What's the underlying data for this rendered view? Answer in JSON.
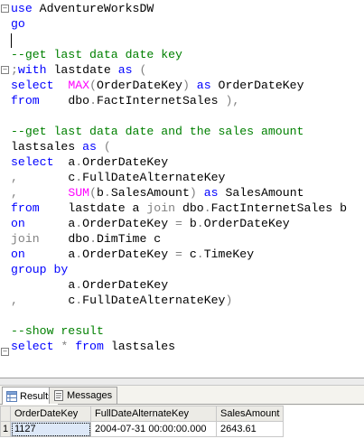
{
  "editor": {
    "lines": [
      [
        {
          "t": "use ",
          "c": "kw"
        },
        {
          "t": "AdventureWorksDW",
          "c": "id"
        }
      ],
      [
        {
          "t": "go",
          "c": "kw"
        }
      ],
      [
        {
          "t": "",
          "c": "id"
        }
      ],
      [
        {
          "t": "--get last data date key",
          "c": "cm"
        }
      ],
      [
        {
          "t": ";",
          "c": "op"
        },
        {
          "t": "with ",
          "c": "kw"
        },
        {
          "t": "lastdate ",
          "c": "id"
        },
        {
          "t": "as ",
          "c": "kw"
        },
        {
          "t": "(",
          "c": "op"
        }
      ],
      [
        {
          "t": "select  ",
          "c": "kw"
        },
        {
          "t": "MAX",
          "c": "fn"
        },
        {
          "t": "(",
          "c": "op"
        },
        {
          "t": "OrderDateKey",
          "c": "id"
        },
        {
          "t": ") ",
          "c": "op"
        },
        {
          "t": "as ",
          "c": "kw"
        },
        {
          "t": "OrderDateKey",
          "c": "id"
        }
      ],
      [
        {
          "t": "from    ",
          "c": "kw"
        },
        {
          "t": "dbo",
          "c": "id"
        },
        {
          "t": ".",
          "c": "op"
        },
        {
          "t": "FactInternetSales ",
          "c": "id"
        },
        {
          "t": "),",
          "c": "op"
        }
      ],
      [
        {
          "t": "",
          "c": "id"
        }
      ],
      [
        {
          "t": "--get last data date and the sales amount",
          "c": "cm"
        }
      ],
      [
        {
          "t": "lastsales ",
          "c": "id"
        },
        {
          "t": "as ",
          "c": "kw"
        },
        {
          "t": "(",
          "c": "op"
        }
      ],
      [
        {
          "t": "select  ",
          "c": "kw"
        },
        {
          "t": "a",
          "c": "id"
        },
        {
          "t": ".",
          "c": "op"
        },
        {
          "t": "OrderDateKey",
          "c": "id"
        }
      ],
      [
        {
          "t": ",       ",
          "c": "op"
        },
        {
          "t": "c",
          "c": "id"
        },
        {
          "t": ".",
          "c": "op"
        },
        {
          "t": "FullDateAlternateKey",
          "c": "id"
        }
      ],
      [
        {
          "t": ",       ",
          "c": "op"
        },
        {
          "t": "SUM",
          "c": "fn"
        },
        {
          "t": "(",
          "c": "op"
        },
        {
          "t": "b",
          "c": "id"
        },
        {
          "t": ".",
          "c": "op"
        },
        {
          "t": "SalesAmount",
          "c": "id"
        },
        {
          "t": ") ",
          "c": "op"
        },
        {
          "t": "as ",
          "c": "kw"
        },
        {
          "t": "SalesAmount",
          "c": "id"
        }
      ],
      [
        {
          "t": "from    ",
          "c": "kw"
        },
        {
          "t": "lastdate a ",
          "c": "id"
        },
        {
          "t": "join ",
          "c": "op"
        },
        {
          "t": "dbo",
          "c": "id"
        },
        {
          "t": ".",
          "c": "op"
        },
        {
          "t": "FactInternetSales b",
          "c": "id"
        }
      ],
      [
        {
          "t": "on      ",
          "c": "kw"
        },
        {
          "t": "a",
          "c": "id"
        },
        {
          "t": ".",
          "c": "op"
        },
        {
          "t": "OrderDateKey ",
          "c": "id"
        },
        {
          "t": "= ",
          "c": "op"
        },
        {
          "t": "b",
          "c": "id"
        },
        {
          "t": ".",
          "c": "op"
        },
        {
          "t": "OrderDateKey",
          "c": "id"
        }
      ],
      [
        {
          "t": "join    ",
          "c": "op"
        },
        {
          "t": "dbo",
          "c": "id"
        },
        {
          "t": ".",
          "c": "op"
        },
        {
          "t": "DimTime c",
          "c": "id"
        }
      ],
      [
        {
          "t": "on      ",
          "c": "kw"
        },
        {
          "t": "a",
          "c": "id"
        },
        {
          "t": ".",
          "c": "op"
        },
        {
          "t": "OrderDateKey ",
          "c": "id"
        },
        {
          "t": "= ",
          "c": "op"
        },
        {
          "t": "c",
          "c": "id"
        },
        {
          "t": ".",
          "c": "op"
        },
        {
          "t": "TimeKey",
          "c": "id"
        }
      ],
      [
        {
          "t": "group by",
          "c": "kw"
        }
      ],
      [
        {
          "t": "        ",
          "c": "id"
        },
        {
          "t": "a",
          "c": "id"
        },
        {
          "t": ".",
          "c": "op"
        },
        {
          "t": "OrderDateKey",
          "c": "id"
        }
      ],
      [
        {
          "t": ",       ",
          "c": "op"
        },
        {
          "t": "c",
          "c": "id"
        },
        {
          "t": ".",
          "c": "op"
        },
        {
          "t": "FullDateAlternateKey",
          "c": "id"
        },
        {
          "t": ")",
          "c": "op"
        }
      ],
      [
        {
          "t": "",
          "c": "id"
        }
      ],
      [
        {
          "t": "--show result",
          "c": "cm"
        }
      ],
      [
        {
          "t": "select ",
          "c": "kw"
        },
        {
          "t": "* ",
          "c": "op"
        },
        {
          "t": "from ",
          "c": "kw"
        },
        {
          "t": "lastsales",
          "c": "id"
        }
      ]
    ]
  },
  "results": {
    "tabs": [
      {
        "label": "Results",
        "icon": "results-grid-icon",
        "active": true
      },
      {
        "label": "Messages",
        "icon": "messages-icon",
        "active": false
      }
    ],
    "columns": [
      "OrderDateKey",
      "FullDateAlternateKey",
      "SalesAmount"
    ],
    "rows": [
      {
        "num": "1",
        "cells": [
          "1127",
          "2004-07-31 00:00:00.000",
          "2643.61"
        ]
      }
    ]
  },
  "colors": {
    "keyword": "#0000ff",
    "function": "#ff00ff",
    "comment": "#008000",
    "operator": "#808080"
  }
}
